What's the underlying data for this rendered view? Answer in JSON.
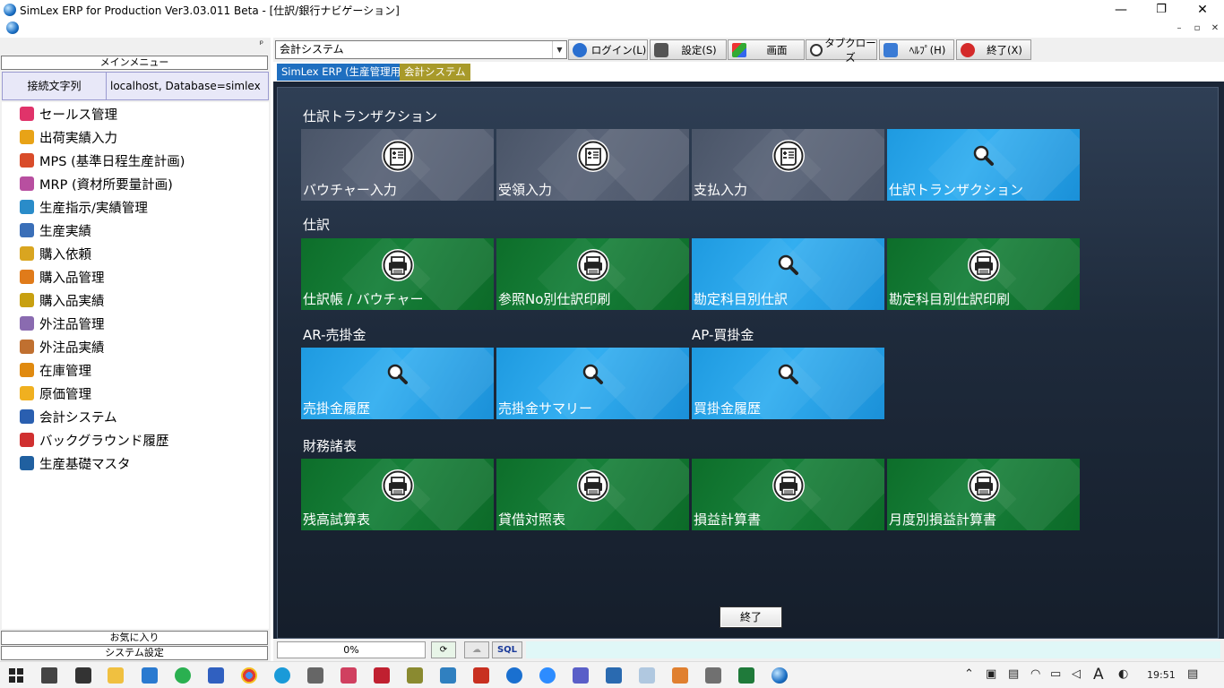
{
  "window": {
    "title": "SimLex ERP for Production Ver3.03.011 Beta - [仕訳/銀行ナビゲーション]",
    "minimize": "—",
    "restore": "❐",
    "close": "✕",
    "mdi_minimize": "–",
    "mdi_restore": "▫",
    "mdi_close": "✕"
  },
  "left": {
    "pin": "ᵖ",
    "main_menu_label": "メインメニュー",
    "conn_key": "接続文字列",
    "conn_value": "localhost, Database=simlex",
    "items": [
      {
        "label": "セールス管理",
        "color": "#e0336a"
      },
      {
        "label": "出荷実績入力",
        "color": "#e8a317"
      },
      {
        "label": "MPS (基準日程生産計画)",
        "color": "#d94c2a"
      },
      {
        "label": "MRP (資材所要量計画)",
        "color": "#b84fa0"
      },
      {
        "label": "生産指示/実績管理",
        "color": "#2a8cc9"
      },
      {
        "label": "生産実績",
        "color": "#3a6fb8"
      },
      {
        "label": "購入依頼",
        "color": "#d9a520"
      },
      {
        "label": "購入品管理",
        "color": "#e07b1a"
      },
      {
        "label": "購入品実績",
        "color": "#c8a010"
      },
      {
        "label": "外注品管理",
        "color": "#8a6bb0"
      },
      {
        "label": "外注品実績",
        "color": "#c07030"
      },
      {
        "label": "在庫管理",
        "color": "#e08a10"
      },
      {
        "label": "原価管理",
        "color": "#f0b020"
      },
      {
        "label": "会計システム",
        "color": "#2a5fb0"
      },
      {
        "label": "バックグラウンド履歴",
        "color": "#d03030"
      },
      {
        "label": "生産基礎マスタ",
        "color": "#2060a0"
      }
    ],
    "favorites_label": "お気に入り",
    "system_settings_label": "システム設定"
  },
  "toolbar": {
    "system_value": "会計システム",
    "login_label": "ログイン(L)",
    "settings_label": "設定(S)",
    "screen_label": "画面",
    "tab_close_label": "タブクローズ",
    "help_label": "ﾍﾙﾌﾟ(H)",
    "exit_label": "終了(X)"
  },
  "tabs": [
    {
      "label": "SimLex ERP (生産管理用)",
      "color": "#1f6fc0"
    },
    {
      "label": "会計システム",
      "color": "#a89a2a"
    }
  ],
  "sections": {
    "journal_transactions": {
      "title": "仕訳トランザクション",
      "tiles": [
        {
          "label": "バウチャー入力",
          "style": "gray",
          "icon": "voucher-icon"
        },
        {
          "label": "受領入力",
          "style": "gray",
          "icon": "voucher-icon"
        },
        {
          "label": "支払入力",
          "style": "gray",
          "icon": "voucher-icon"
        },
        {
          "label": "仕訳トランザクション",
          "style": "blue",
          "icon": "search-icon"
        }
      ]
    },
    "journal": {
      "title": "仕訳",
      "tiles": [
        {
          "label": "仕訳帳 / バウチャー",
          "style": "green",
          "icon": "printer-icon"
        },
        {
          "label": "参照No別仕訳印刷",
          "style": "green",
          "icon": "printer-icon"
        },
        {
          "label": "勘定科目別仕訳",
          "style": "blue",
          "icon": "search-icon"
        },
        {
          "label": "勘定科目別仕訳印刷",
          "style": "green",
          "icon": "printer-icon"
        }
      ]
    },
    "ar": {
      "title": "AR-売掛金",
      "tiles": [
        {
          "label": "売掛金履歴",
          "style": "blue",
          "icon": "search-icon"
        },
        {
          "label": "売掛金サマリー",
          "style": "blue",
          "icon": "search-icon"
        }
      ]
    },
    "ap": {
      "title": "AP-買掛金",
      "tiles": [
        {
          "label": "買掛金履歴",
          "style": "blue",
          "icon": "search-icon"
        }
      ]
    },
    "financial_statements": {
      "title": "財務諸表",
      "tiles": [
        {
          "label": "残高試算表",
          "style": "green",
          "icon": "printer-icon"
        },
        {
          "label": "貸借対照表",
          "style": "green",
          "icon": "printer-icon"
        },
        {
          "label": "損益計算書",
          "style": "green",
          "icon": "printer-icon"
        },
        {
          "label": "月度別損益計算書",
          "style": "green",
          "icon": "printer-icon"
        }
      ]
    }
  },
  "exit_button_label": "終了",
  "status": {
    "progress_text": "0%",
    "progress_value": 0,
    "sql_label": "SQL"
  },
  "taskbar": {
    "time": "19:51",
    "ime": "A"
  }
}
